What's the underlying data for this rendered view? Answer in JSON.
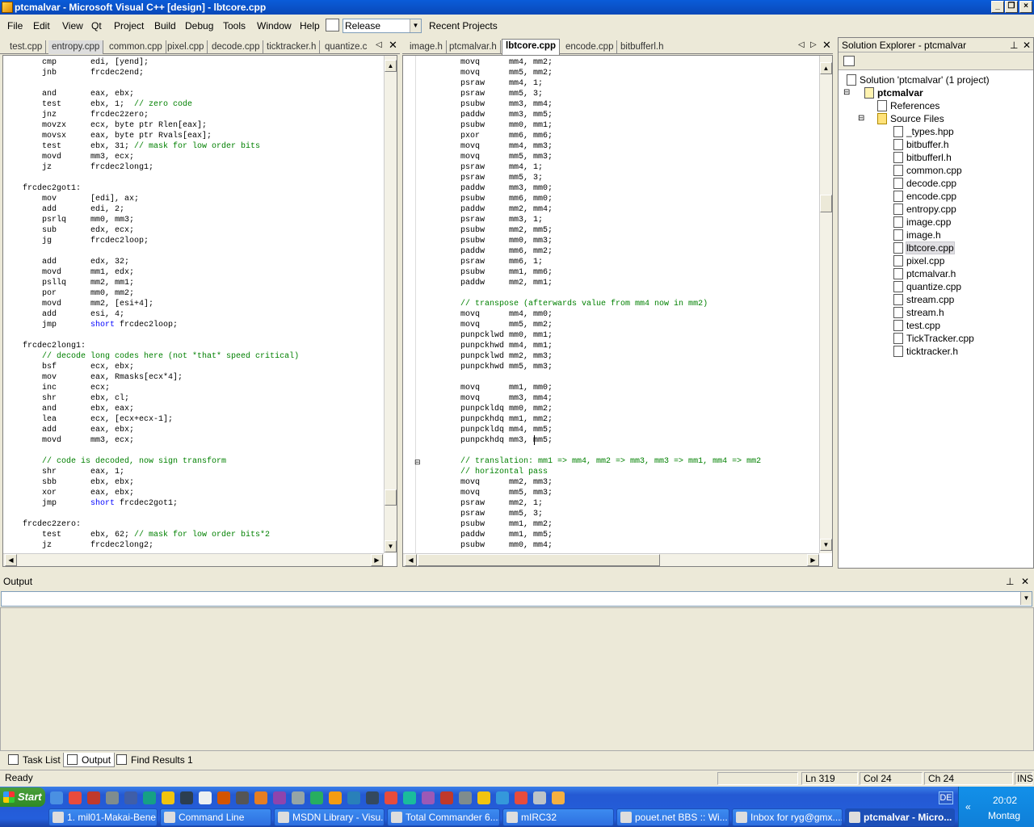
{
  "window": {
    "title": "ptcmalvar - Microsoft Visual C++ [design] - lbtcore.cpp"
  },
  "menu": [
    "File",
    "Edit",
    "View",
    "Qt",
    "Project",
    "Build",
    "Debug",
    "Tools",
    "Window",
    "Help"
  ],
  "toolbar": {
    "config": "Release",
    "recent": "Recent Projects"
  },
  "left_tabs": [
    "test.cpp",
    "entropy.cpp",
    "common.cpp",
    "pixel.cpp",
    "decode.cpp",
    "ticktracker.h",
    "quantize.c"
  ],
  "right_tabs": [
    "image.h",
    "ptcmalvar.h",
    "lbtcore.cpp",
    "encode.cpp",
    "bitbufferl.h"
  ],
  "left_code": [
    "    cmp       edi, [yend];",
    "    jnb       frcdec2end;",
    "",
    "    and       eax, ebx;",
    "    test      ebx, 1;  // zero code",
    "    jnz       frcdec2zero;",
    "    movzx     ecx, byte ptr Rlen[eax];",
    "    movsx     eax, byte ptr Rvals[eax];",
    "    test      ebx, 31; // mask for low order bits",
    "    movd      mm3, ecx;",
    "    jz        frcdec2long1;",
    "",
    "frcdec2got1:",
    "    mov       [edi], ax;",
    "    add       edi, 2;",
    "    psrlq     mm0, mm3;",
    "    sub       edx, ecx;",
    "    jg        frcdec2loop;",
    "",
    "    add       edx, 32;",
    "    movd      mm1, edx;",
    "    psllq     mm2, mm1;",
    "    por       mm0, mm2;",
    "    movd      mm2, [esi+4];",
    "    add       esi, 4;",
    "    jmp       short frcdec2loop;",
    "",
    "frcdec2long1:",
    "    // decode long codes here (not *that* speed critical)",
    "    bsf       ecx, ebx;",
    "    mov       eax, Rmasks[ecx*4];",
    "    inc       ecx;",
    "    shr       ebx, cl;",
    "    and       ebx, eax;",
    "    lea       ecx, [ecx+ecx-1];",
    "    add       eax, ebx;",
    "    movd      mm3, ecx;",
    "",
    "    // code is decoded, now sign transform",
    "    shr       eax, 1;",
    "    sbb       ebx, ebx;",
    "    xor       eax, ebx;",
    "    jmp       short frcdec2got1;",
    "",
    "frcdec2zero:",
    "    test      ebx, 62; // mask for low order bits*2",
    "    jz        frcdec2long2;"
  ],
  "right_code": [
    "    movq      mm4, mm2;",
    "    movq      mm5, mm2;",
    "    psraw     mm4, 1;",
    "    psraw     mm5, 3;",
    "    psubw     mm3, mm4;",
    "    paddw     mm3, mm5;",
    "    psubw     mm0, mm1;",
    "    pxor      mm6, mm6;",
    "    movq      mm4, mm3;",
    "    movq      mm5, mm3;",
    "    psraw     mm4, 1;",
    "    psraw     mm5, 3;",
    "    paddw     mm3, mm0;",
    "    psubw     mm6, mm0;",
    "    paddw     mm2, mm4;",
    "    psraw     mm3, 1;",
    "    psubw     mm2, mm5;",
    "    psubw     mm0, mm3;",
    "    paddw     mm6, mm2;",
    "    psraw     mm6, 1;",
    "    psubw     mm1, mm6;",
    "    paddw     mm2, mm1;",
    "",
    "    // transpose (afterwards value from mm4 now in mm2)",
    "    movq      mm4, mm0;",
    "    movq      mm5, mm2;",
    "    punpcklwd mm0, mm1;",
    "    punpckhwd mm4, mm1;",
    "    punpcklwd mm2, mm3;",
    "    punpckhwd mm5, mm3;",
    "",
    "    movq      mm1, mm0;",
    "    movq      mm3, mm4;",
    "    punpckldq mm0, mm2;",
    "    punpckhdq mm1, mm2;",
    "    punpckldq mm4, mm5;",
    "    punpckhdq mm3, mm5;",
    "",
    "    // translation: mm1 => mm4, mm2 => mm3, mm3 => mm1, mm4 => mm2",
    "    // horizontal pass",
    "    movq      mm2, mm3;",
    "    movq      mm5, mm3;",
    "    psraw     mm2, 1;",
    "    psraw     mm5, 3;",
    "    psubw     mm1, mm2;",
    "    paddw     mm1, mm5;",
    "    psubw     mm0, mm4;"
  ],
  "solution": {
    "header": "Solution Explorer - ptcmalvar",
    "root": "Solution 'ptcmalvar' (1 project)",
    "project": "ptcmalvar",
    "references": "References",
    "source_files": "Source Files",
    "files": [
      "_types.hpp",
      "bitbuffer.h",
      "bitbufferl.h",
      "common.cpp",
      "decode.cpp",
      "encode.cpp",
      "entropy.cpp",
      "image.cpp",
      "image.h",
      "lbtcore.cpp",
      "pixel.cpp",
      "ptcmalvar.h",
      "quantize.cpp",
      "stream.cpp",
      "stream.h",
      "test.cpp",
      "TickTracker.cpp",
      "ticktracker.h"
    ],
    "selected": "lbtcore.cpp"
  },
  "output": {
    "header": "Output"
  },
  "bottom_tabs": [
    "Task List",
    "Output",
    "Find Results 1"
  ],
  "status": {
    "ready": "Ready",
    "ln": "Ln 319",
    "col": "Col 24",
    "ch": "Ch 24",
    "ins": "INS"
  },
  "taskbar": {
    "start": "Start",
    "lang": "DE",
    "tasks": [
      "1. mil01-Makai-Bene...",
      "Command Line",
      "MSDN Library - Visu...",
      "Total Commander 6....",
      "mIRC32",
      "pouet.net BBS :: Wi...",
      "Inbox for ryg@gmx....",
      "ptcmalvar - Micro..."
    ],
    "time": "20:02",
    "day": "Montag"
  }
}
